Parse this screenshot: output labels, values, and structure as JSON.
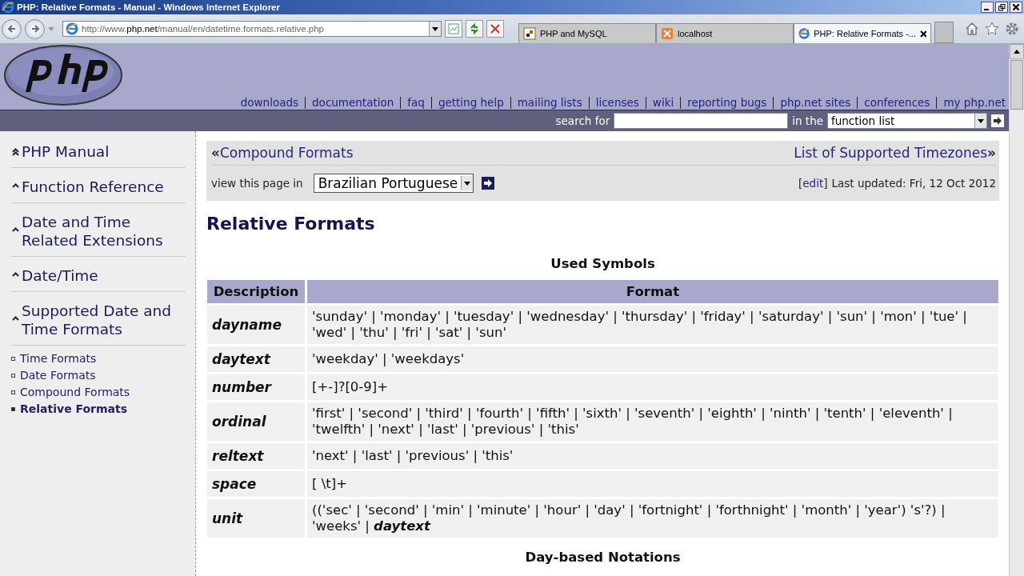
{
  "window": {
    "title": "PHP: Relative Formats - Manual - Windows Internet Explorer"
  },
  "address_bar": {
    "value_prefix": "http://www.",
    "value_domain": "php.net",
    "value_path": "/manual/en/datetime.formats.relative.php"
  },
  "browser_tabs": [
    {
      "label": "PHP and MySQL",
      "kind": "page",
      "selected": false
    },
    {
      "label": "localhost",
      "kind": "xampp",
      "selected": false
    },
    {
      "label": "PHP: Relative Formats -...",
      "kind": "ie",
      "selected": true
    }
  ],
  "header": {
    "links": [
      "downloads",
      "documentation",
      "faq",
      "getting help",
      "mailing lists",
      "licenses",
      "wiki",
      "reporting bugs",
      "php.net sites",
      "conferences",
      "my php.net"
    ],
    "search_label": "search for",
    "in_label": "in the",
    "scope": "function list"
  },
  "sidebar": {
    "trail": [
      {
        "label": "PHP Manual",
        "kind": "top"
      },
      {
        "label": "Function Reference",
        "kind": "parent"
      },
      {
        "label": "Date and Time Related Extensions",
        "kind": "parent"
      },
      {
        "label": "Date/Time",
        "kind": "parent"
      },
      {
        "label": "Supported Date and Time Formats",
        "kind": "parent"
      }
    ],
    "items": [
      {
        "label": "Time Formats",
        "selected": false
      },
      {
        "label": "Date Formats",
        "selected": false
      },
      {
        "label": "Compound Formats",
        "selected": false
      },
      {
        "label": "Relative Formats",
        "selected": true
      }
    ]
  },
  "page_nav": {
    "prev": "Compound Formats",
    "prev_mark": "«",
    "next": "List of Supported Timezones",
    "next_mark": "»",
    "view_label": "view this page in",
    "language": "Brazilian Portuguese",
    "edit_open": "[",
    "edit": "edit",
    "edit_close": "]",
    "updated": "Last updated: Fri, 12 Oct 2012"
  },
  "heading": "Relative Formats",
  "table": {
    "caption": "Used Symbols",
    "columns": [
      "Description",
      "Format"
    ],
    "rows": [
      {
        "name": "dayname",
        "format": "'sunday' | 'monday' | 'tuesday' | 'wednesday' | 'thursday' | 'friday' | 'saturday' | 'sun' | 'mon' | 'tue' | 'wed' | 'thu' | 'fri' | 'sat' | 'sun'"
      },
      {
        "name": "daytext",
        "format": "'weekday' | 'weekdays'"
      },
      {
        "name": "number",
        "format": "[+-]?[0-9]+"
      },
      {
        "name": "ordinal",
        "format": "'first' | 'second' | 'third' | 'fourth' | 'fifth' | 'sixth' | 'seventh' | 'eighth' | 'ninth' | 'tenth' | 'eleventh' | 'twelfth' | 'next' | 'last' | 'previous' | 'this'"
      },
      {
        "name": "reltext",
        "format": "'next' | 'last' | 'previous' | 'this'"
      },
      {
        "name": "space",
        "format": "[ \\t]+"
      },
      {
        "name": "unit",
        "format": "(('sec' | 'second' | 'min' | 'minute' | 'hour' | 'day' | 'fortnight' | 'forthnight' | 'month' | 'year') 's'?) | 'weeks' | **daytext**"
      }
    ]
  },
  "next_caption": "Day-based Notations"
}
